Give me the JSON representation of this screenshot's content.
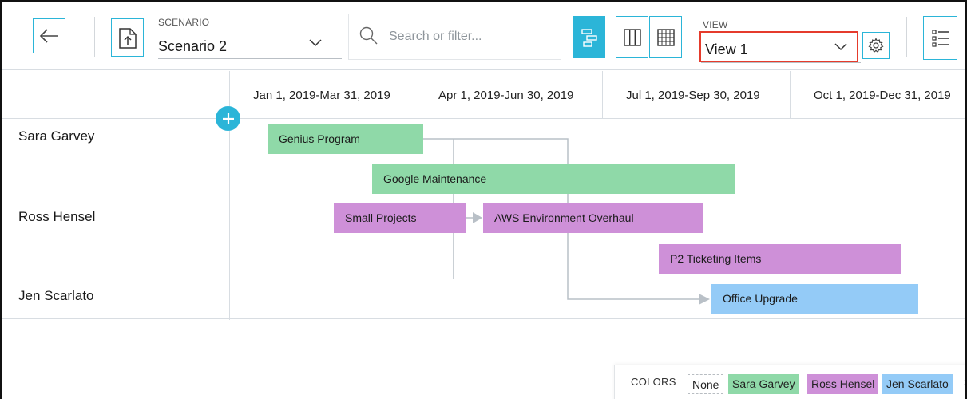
{
  "toolbar": {
    "scenario_label": "SCENARIO",
    "scenario_value": "Scenario 2",
    "search_placeholder": "Search or filter...",
    "view_label": "VIEW",
    "view_value": "View 1"
  },
  "timeline": {
    "quarters": [
      "Jan 1, 2019-Mar 31, 2019",
      "Apr 1, 2019-Jun 30, 2019",
      "Jul 1, 2019-Sep 30, 2019",
      "Oct 1, 2019-Dec 31, 2019"
    ]
  },
  "rows": [
    {
      "name": "Sara Garvey"
    },
    {
      "name": "Ross Hensel"
    },
    {
      "name": "Jen Scarlato"
    }
  ],
  "bars": {
    "genius": "Genius Program",
    "google": "Google Maintenance",
    "small": "Small Projects",
    "aws": "AWS Environment Overhaul",
    "p2": "P2 Ticketing Items",
    "office": "Office Upgrade"
  },
  "legend": {
    "title": "COLORS",
    "none": "None",
    "sara": "Sara Garvey",
    "ross": "Ross Hensel",
    "jen": "Jen Scarlato",
    "more": "›"
  },
  "colors": {
    "accent": "#2bb5d8",
    "sara_green": "#8fd9a8",
    "ross_purple": "#ce90d8",
    "jen_blue": "#94cbf7",
    "highlight_red": "#e53b2c"
  },
  "icons": [
    "back-arrow-icon",
    "export-icon",
    "chevron-down-icon",
    "search-icon",
    "gantt-view-icon",
    "columns-view-icon",
    "grid-view-icon",
    "gear-icon",
    "list-icon",
    "plus-icon"
  ]
}
